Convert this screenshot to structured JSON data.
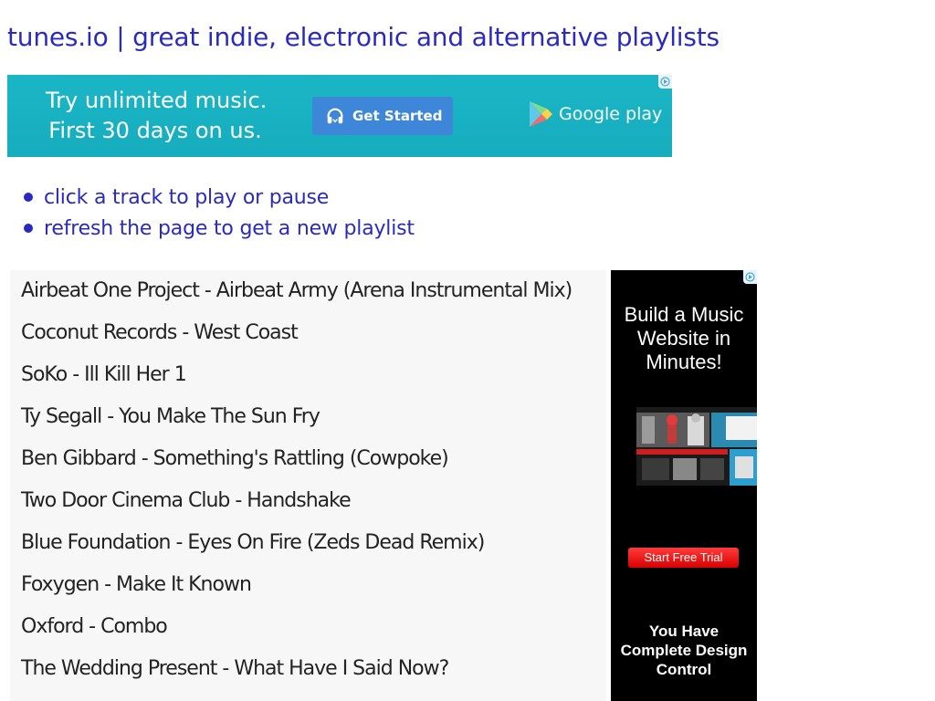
{
  "page": {
    "title": "tunes.io | great indie, electronic and alternative playlists"
  },
  "banner_ad": {
    "line1": "Try unlimited music.",
    "line2": "First 30 days on us.",
    "button_label": "Get Started",
    "brand": "Google play",
    "background_color": "#16adbd",
    "button_color": "#3d86d8",
    "button_icon": "headphones-icon",
    "brand_icon": "play-triangle-icon",
    "adchoices_icon": "adchoices-icon"
  },
  "instructions": [
    "click a track to play or pause",
    "refresh the page to get a new playlist"
  ],
  "playlist": [
    "Airbeat One Project - Airbeat Army (Arena Instrumental Mix)",
    "Coconut Records - West Coast",
    "SoKo - Ill Kill Her 1",
    "Ty Segall - You Make The Sun Fry",
    "Ben Gibbard - Something's Rattling (Cowpoke)",
    "Two Door Cinema Club - Handshake",
    "Blue Foundation - Eyes On Fire (Zeds Dead Remix)",
    "Foxygen - Make It Known",
    "Oxford - Combo",
    "The Wedding Present - What Have I Said Now?"
  ],
  "side_ad": {
    "headline_line1": "Build a Music",
    "headline_line2": "Website in",
    "headline_line3": "Minutes!",
    "button_label": "Start Free Trial",
    "tagline_line1": "You Have",
    "tagline_line2": "Complete Design",
    "tagline_line3": "Control",
    "button_color": "#e80000",
    "adchoices_icon": "adchoices-icon"
  },
  "colors": {
    "link_blue": "#2a2abf",
    "playlist_bg": "#f7f7f7"
  }
}
